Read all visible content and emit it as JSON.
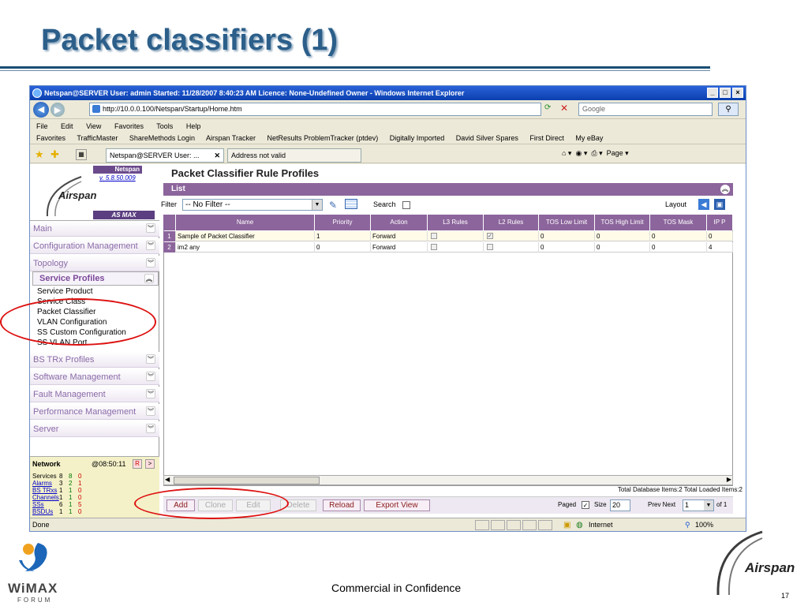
{
  "slide": {
    "title": "Packet classifiers (1)",
    "footer": "Commercial in Confidence",
    "page_number": "17",
    "wimax_logo": "WiMAX",
    "forum_logo": "FORUM",
    "airspan_logo": "Airspan"
  },
  "browser": {
    "title": "Netspan@SERVER User: admin Started: 11/28/2007 8:40:23 AM Licence: None-Undefined Owner - Windows Internet Explorer",
    "url": "http://10.0.0.100/Netspan/Startup/Home.htm",
    "search_placeholder": "Google",
    "menu": [
      "File",
      "Edit",
      "View",
      "Favorites",
      "Tools",
      "Help"
    ],
    "favorites": [
      "Favorites",
      "TrafficMaster",
      "ShareMethods Login",
      "Airspan Tracker",
      "NetResults ProblemTracker (ptdev)",
      "Digitally Imported",
      "David Silver Spares",
      "First Direct",
      "My eBay"
    ],
    "tabs": [
      "Netspan@SERVER User: ...",
      "Address not valid"
    ],
    "toolbar_page": "Page",
    "status_done": "Done",
    "status_zone": "Internet",
    "status_zoom": "100%"
  },
  "sidebar": {
    "netspan_badge": "Netspan",
    "version": "v. 5.8.50.009",
    "logo_text": "Airspan",
    "asmax": "AS MAX",
    "sections_top": [
      "Main",
      "Configuration Management",
      "Topology"
    ],
    "service_profiles_title": "Service Profiles",
    "service_profiles_items": [
      "Service Product",
      "Service Class",
      "Packet Classifier",
      "VLAN Configuration",
      "SS Custom Configuration",
      "SS VLAN Port"
    ],
    "sections_bottom": [
      "BS TRx Profiles",
      "Software Management",
      "Fault Management",
      "Performance Management",
      "Server"
    ],
    "network": {
      "label": "Network",
      "time": "@08:50:11",
      "btn_r": "R",
      "btn_next": ">",
      "rows": [
        {
          "name": "Services",
          "a": "8",
          "b": "8",
          "c": "0",
          "link": false
        },
        {
          "name": "Alarms",
          "a": "3",
          "b": "2",
          "c": "1",
          "link": true
        },
        {
          "name": "BS TRxs",
          "a": "1",
          "b": "1",
          "c": "0",
          "link": true
        },
        {
          "name": "Channels",
          "a": "1",
          "b": "1",
          "c": "0",
          "link": true
        },
        {
          "name": "SSs",
          "a": "6",
          "b": "1",
          "c": "5",
          "link": true
        },
        {
          "name": "BSDUs",
          "a": "1",
          "b": "1",
          "c": "0",
          "link": true
        }
      ]
    }
  },
  "main": {
    "title": "Packet Classifier Rule Profiles",
    "list_label": "List",
    "filter_label": "Filter",
    "filter_value": "-- No Filter --",
    "search_label": "Search",
    "layout_label": "Layout",
    "columns": [
      "Name",
      "Priority",
      "Action",
      "L3 Rules",
      "L2 Rules",
      "TOS Low Limit",
      "TOS High Limit",
      "TOS Mask",
      "IP P"
    ],
    "rows": [
      {
        "num": "1",
        "name": "Sample of Packet Classifier",
        "priority": "1",
        "action": "Forward",
        "l3": false,
        "l2": true,
        "tos_low": "0",
        "tos_high": "0",
        "tos_mask": "0",
        "ip": "0"
      },
      {
        "num": "2",
        "name": "im2 any",
        "priority": "0",
        "action": "Forward",
        "l3": false,
        "l2": false,
        "tos_low": "0",
        "tos_high": "0",
        "tos_mask": "0",
        "ip": "4"
      }
    ],
    "totals": "Total Database Items:2  Total Loaded Items:2",
    "buttons": {
      "add": "Add",
      "clone": "Clone",
      "edit": "Edit",
      "delete": "Delete",
      "reload": "Reload",
      "export": "Export View"
    },
    "paged_label": "Paged",
    "size_label": "Size",
    "size_value": "20",
    "prev_next": "Prev Next",
    "page_value": "1",
    "of_label": "of 1"
  }
}
